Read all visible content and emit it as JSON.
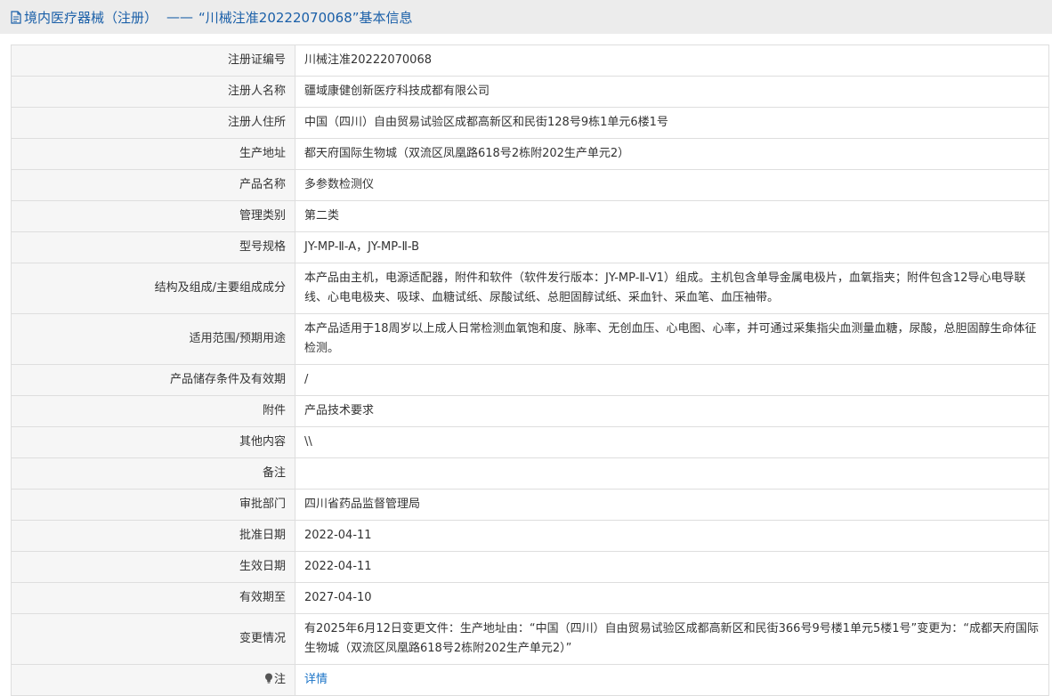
{
  "header": {
    "title_prefix": "境内医疗器械（注册）",
    "separator": "——",
    "title_suffix": "“川械注准20222070068”基本信息",
    "accent_color": "#1a5fa8"
  },
  "rows": [
    {
      "label": "注册证编号",
      "value": "川械注准20222070068"
    },
    {
      "label": "注册人名称",
      "value": "疆域康健创新医疗科技成都有限公司"
    },
    {
      "label": "注册人住所",
      "value": "中国（四川）自由贸易试验区成都高新区和民街128号9栋1单元6楼1号"
    },
    {
      "label": "生产地址",
      "value": "都天府国际生物城（双流区凤凰路618号2栋附202生产单元2）"
    },
    {
      "label": "产品名称",
      "value": "多参数检测仪"
    },
    {
      "label": "管理类别",
      "value": "第二类"
    },
    {
      "label": "型号规格",
      "value": "JY-MP-Ⅱ-A，JY-MP-Ⅱ-B"
    },
    {
      "label": "结构及组成/主要组成成分",
      "value": "本产品由主机，电源适配器，附件和软件（软件发行版本：JY-MP-Ⅱ-V1）组成。主机包含单导金属电极片，血氧指夹；附件包含12导心电导联线、心电电极夹、吸球、血糖试纸、尿酸试纸、总胆固醇试纸、采血针、采血笔、血压袖带。"
    },
    {
      "label": "适用范围/预期用途",
      "value": "本产品适用于18周岁以上成人日常检测血氧饱和度、脉率、无创血压、心电图、心率，并可通过采集指尖血测量血糖，尿酸，总胆固醇生命体征检测。"
    },
    {
      "label": "产品储存条件及有效期",
      "value": "/"
    },
    {
      "label": "附件",
      "value": "产品技术要求"
    },
    {
      "label": "其他内容",
      "value": "\\\\"
    },
    {
      "label": "备注",
      "value": ""
    },
    {
      "label": "审批部门",
      "value": "四川省药品监督管理局"
    },
    {
      "label": "批准日期",
      "value": "2022-04-11"
    },
    {
      "label": "生效日期",
      "value": "2022-04-11"
    },
    {
      "label": "有效期至",
      "value": "2027-04-10"
    },
    {
      "label": "变更情况",
      "value": "有2025年6月12日变更文件：生产地址由：“中国（四川）自由贸易试验区成都高新区和民街366号9号楼1单元5楼1号”变更为：“成都天府国际生物城（双流区凤凰路618号2栋附202生产单元2）”"
    }
  ],
  "note": {
    "label": "注",
    "link_text": "详情",
    "icon": "lightbulb-icon",
    "link_color": "#1a73c7"
  }
}
